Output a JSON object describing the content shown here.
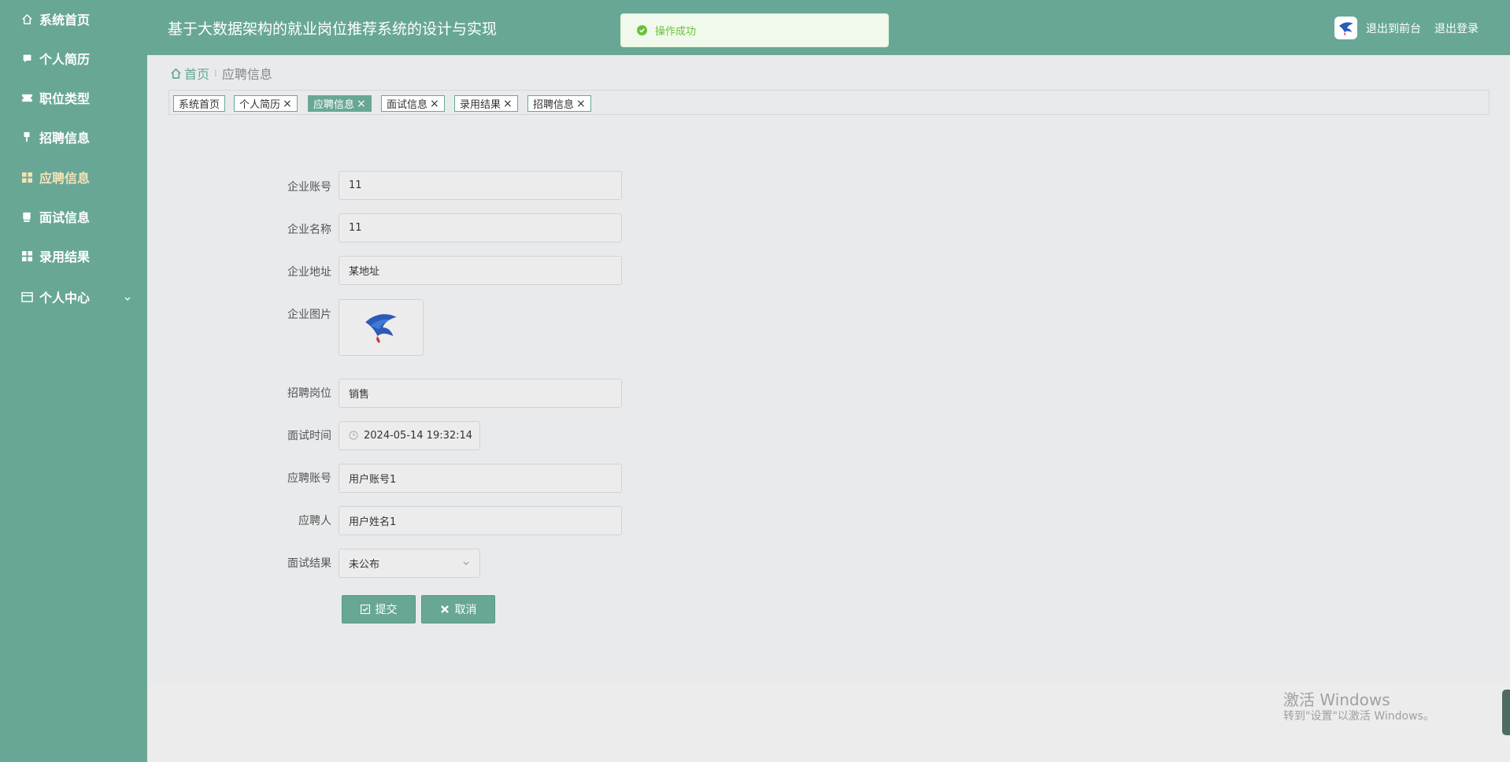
{
  "sidebar": {
    "items": [
      {
        "label": "系统首页",
        "icon": "home-icon"
      },
      {
        "label": "个人简历",
        "icon": "chat-icon"
      },
      {
        "label": "职位类型",
        "icon": "ticket-icon"
      },
      {
        "label": "招聘信息",
        "icon": "pin-icon"
      },
      {
        "label": "应聘信息",
        "icon": "grid-icon",
        "active": true
      },
      {
        "label": "面试信息",
        "icon": "cup-icon"
      },
      {
        "label": "录用结果",
        "icon": "apps-icon"
      },
      {
        "label": "个人中心",
        "icon": "card-icon",
        "expandable": true
      }
    ]
  },
  "header": {
    "title": "基于大数据架构的就业岗位推荐系统的设计与实现",
    "links": [
      "退出到前台",
      "退出登录"
    ]
  },
  "toast": {
    "text": "操作成功",
    "color": "#67c23a"
  },
  "breadcrumb": {
    "home": "首页",
    "current": "应聘信息"
  },
  "tags": [
    {
      "label": "系统首页",
      "closable": false
    },
    {
      "label": "个人简历",
      "closable": true
    },
    {
      "label": "应聘信息",
      "closable": true,
      "active": true
    },
    {
      "label": "面试信息",
      "closable": true
    },
    {
      "label": "录用结果",
      "closable": true
    },
    {
      "label": "招聘信息",
      "closable": true
    }
  ],
  "form": {
    "company_account": {
      "label": "企业账号",
      "value": "11"
    },
    "company_name": {
      "label": "企业名称",
      "value": "11"
    },
    "company_address": {
      "label": "企业地址",
      "value": "某地址"
    },
    "company_image": {
      "label": "企业图片"
    },
    "job_position": {
      "label": "招聘岗位",
      "value": "销售"
    },
    "interview_time": {
      "label": "面试时间",
      "value": "2024-05-14 19:32:14"
    },
    "applicant_account": {
      "label": "应聘账号",
      "value": "用户账号1"
    },
    "applicant": {
      "label": "应聘人",
      "value": "用户姓名1"
    },
    "interview_result": {
      "label": "面试结果",
      "value": "未公布"
    },
    "submit_label": "提交",
    "cancel_label": "取消"
  },
  "watermark": {
    "title": "激活 Windows",
    "subtitle": "转到\"设置\"以激活 Windows。"
  },
  "colors": {
    "theme": "#68a796",
    "active_nav": "#f5e3b5",
    "background": "#e9eaec"
  }
}
